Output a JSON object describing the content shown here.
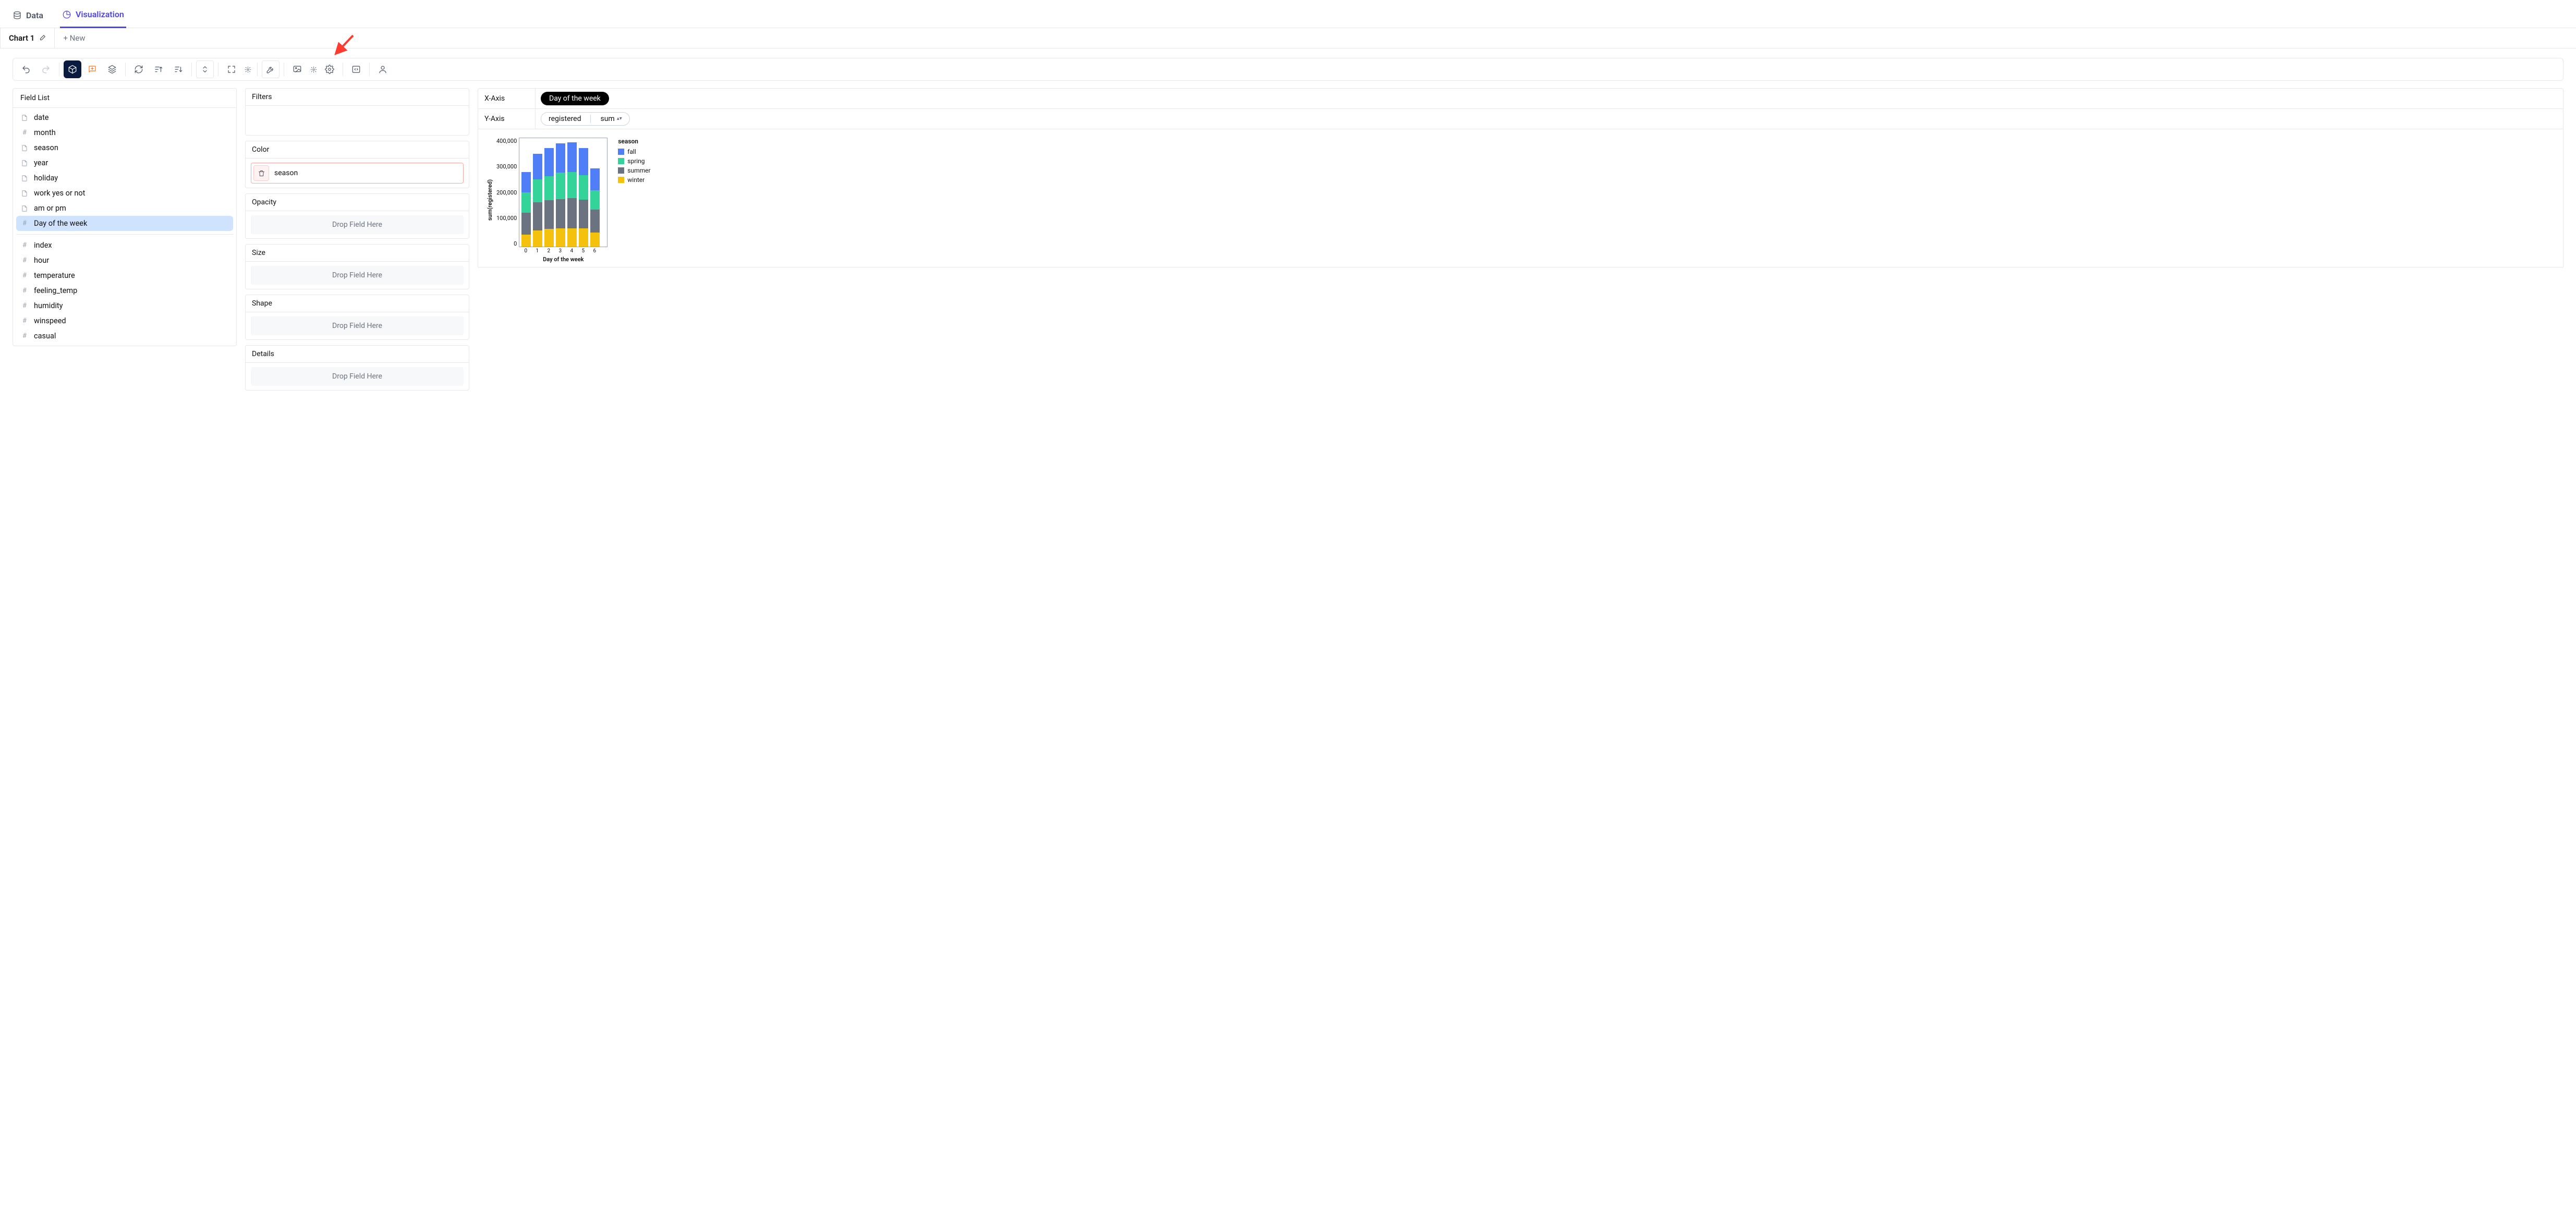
{
  "tabs": {
    "data": "Data",
    "visualization": "Visualization"
  },
  "chart_tabs": {
    "chart1": "Chart 1",
    "new": "+ New"
  },
  "panels": {
    "field_list_title": "Field List",
    "filters": "Filters",
    "color": "Color",
    "opacity": "Opacity",
    "size": "Size",
    "shape": "Shape",
    "details": "Details",
    "drop_hint": "Drop Field Here"
  },
  "fields": {
    "main": [
      {
        "name": "date",
        "kind": "doc"
      },
      {
        "name": "month",
        "kind": "num"
      },
      {
        "name": "season",
        "kind": "doc"
      },
      {
        "name": "year",
        "kind": "doc"
      },
      {
        "name": "holiday",
        "kind": "doc"
      },
      {
        "name": "work yes or not",
        "kind": "doc"
      },
      {
        "name": "am or pm",
        "kind": "doc"
      },
      {
        "name": "Day of the week",
        "kind": "num",
        "selected": true
      }
    ],
    "more": [
      {
        "name": "index",
        "kind": "num"
      },
      {
        "name": "hour",
        "kind": "num"
      },
      {
        "name": "temperature",
        "kind": "num"
      },
      {
        "name": "feeling_temp",
        "kind": "num"
      },
      {
        "name": "humidity",
        "kind": "num"
      },
      {
        "name": "winspeed",
        "kind": "num"
      },
      {
        "name": "casual",
        "kind": "num"
      }
    ]
  },
  "color_encoding_field": "season",
  "axes": {
    "x_label": "X-Axis",
    "y_label": "Y-Axis",
    "x_value": "Day of the week",
    "y_value": "registered",
    "y_agg": "sum"
  },
  "chart_data": {
    "type": "bar",
    "stacked": true,
    "title": "",
    "xlabel": "Day of the week",
    "ylabel": "sum(registered)",
    "ylim": [
      0,
      450000
    ],
    "y_ticks": [
      0,
      100000,
      200000,
      300000,
      400000
    ],
    "y_tick_labels": [
      "0",
      "100,000",
      "200,000",
      "300,000",
      "400,000"
    ],
    "categories": [
      "0",
      "1",
      "2",
      "3",
      "4",
      "5",
      "6"
    ],
    "legend_title": "season",
    "series": [
      {
        "name": "winter",
        "color": "#f4c20d",
        "values": [
          50000,
          67000,
          72000,
          74000,
          76000,
          75000,
          57000
        ]
      },
      {
        "name": "summer",
        "color": "#6b7280",
        "values": [
          90000,
          115000,
          118000,
          122000,
          123000,
          118000,
          95000
        ]
      },
      {
        "name": "spring",
        "color": "#34d399",
        "values": [
          82000,
          95000,
          100000,
          108000,
          108000,
          100000,
          80000
        ]
      },
      {
        "name": "fall",
        "color": "#4f7ef7",
        "values": [
          85000,
          105000,
          115000,
          120000,
          122000,
          113000,
          90000
        ]
      }
    ],
    "legend_order": [
      "fall",
      "spring",
      "summer",
      "winter"
    ],
    "legend_colors": {
      "fall": "#4f7ef7",
      "spring": "#34d399",
      "summer": "#6b7280",
      "winter": "#f4c20d"
    }
  }
}
